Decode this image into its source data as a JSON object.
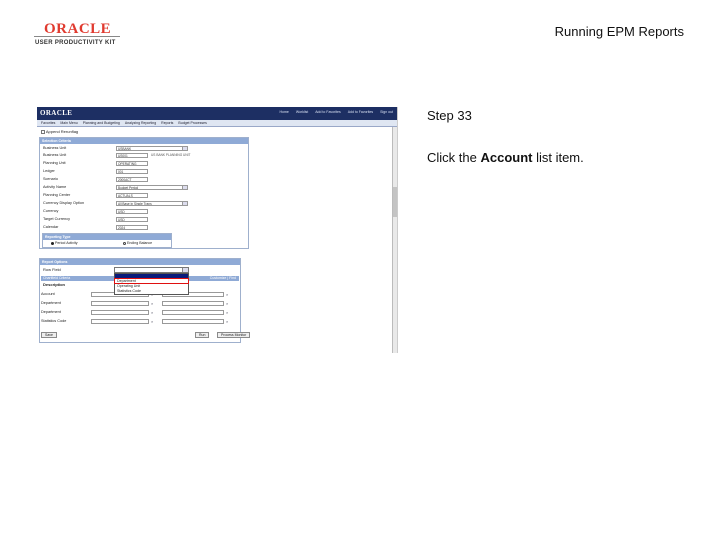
{
  "header": {
    "brand": "ORACLE",
    "brand_sub": "USER PRODUCTIVITY KIT",
    "doc_title": "Running EPM Reports"
  },
  "step": {
    "label": "Step 33",
    "instruction_prefix": "Click the ",
    "instruction_bold": "Account",
    "instruction_suffix": " list item."
  },
  "screenshot": {
    "oracle_logo": "ORACLE",
    "nav_links": [
      "Home",
      "Worklist",
      "Add to Favorites",
      "Add to Favorites",
      "Sign out"
    ],
    "menu_items": [
      "Favorites",
      "Main Menu",
      "Planning and Budgeting",
      "Analyzing Reporting",
      "Reports",
      "Budget Processes"
    ],
    "checkbox_label": "Append Rerunflag",
    "criteria_title": "Selection Criteria",
    "fields": [
      {
        "label": "Business Unit",
        "value": "USBANK",
        "type": "select"
      },
      {
        "label": "Business Unit",
        "value": "US001",
        "extra": "US BANK PLANNING UNIT"
      },
      {
        "label": "Planning Unit",
        "value": "OPERATING"
      },
      {
        "label": "Ledger",
        "value": "001"
      },
      {
        "label": "Scenario",
        "value": "2000ACT"
      },
      {
        "label": "Activity Name",
        "value": "Budget Period",
        "type": "select"
      },
      {
        "label": "Planning Center",
        "value": "ACTUALS"
      },
      {
        "label": "Currency Display Option",
        "value": "All Base in Single Trans",
        "type": "select"
      },
      {
        "label": "Currency",
        "value": "USD"
      },
      {
        "label": "Target Currency",
        "value": "USD"
      },
      {
        "label": "Calendar",
        "value": "2024"
      }
    ],
    "reporting_type_title": "Reporting Type",
    "radio_period": "Period Activity",
    "radio_ending": "Ending Balance",
    "report_options_title": "Report Options",
    "rows_label": "Row Field",
    "dropdown_options": [
      "",
      "Department",
      "Operating Unit",
      "Statistics Code"
    ],
    "grid_title": "Chartfield Criteria",
    "grid_customize": "Customize | Find",
    "grid_col1": "Description",
    "grid_col2": "To Value",
    "grid_rows": [
      "Account",
      "Department",
      "Department",
      "Statistics Code"
    ],
    "btn_save": "Save",
    "btn_run": "Run",
    "btn_process_monitor": "Process Monitor"
  }
}
